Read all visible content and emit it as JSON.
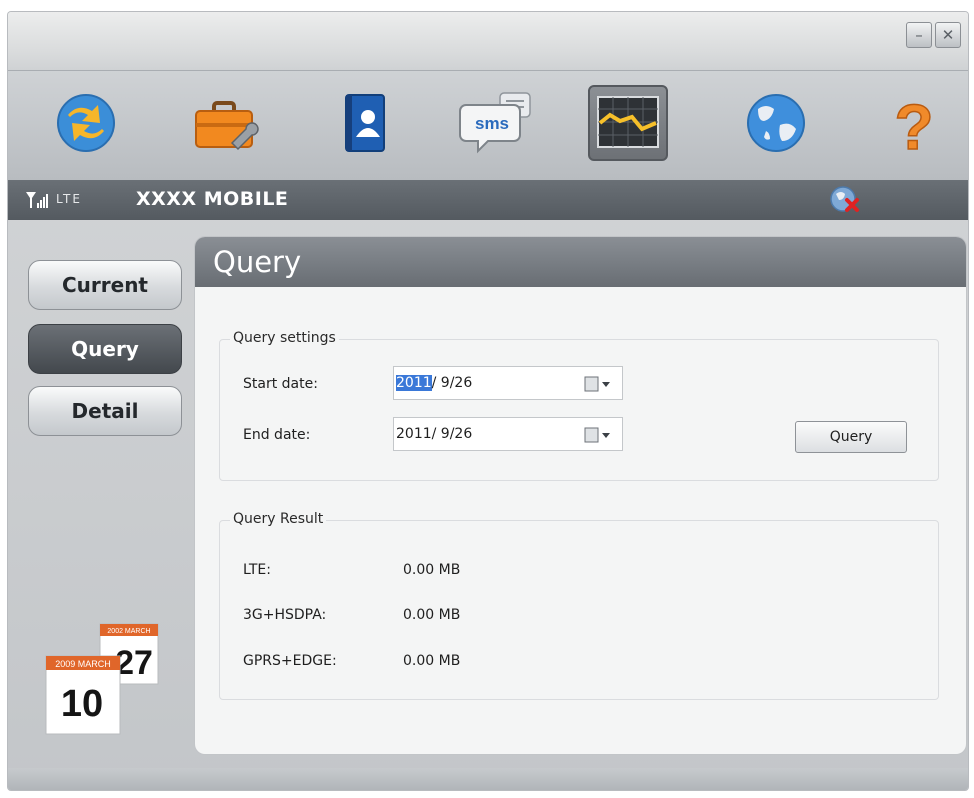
{
  "window": {
    "minimize_label": "–",
    "close_label": "✕"
  },
  "toolbar": {
    "items": [
      {
        "name": "connect",
        "icon": "globe-refresh-icon"
      },
      {
        "name": "settings",
        "icon": "toolbox-icon"
      },
      {
        "name": "contacts",
        "icon": "contact-book-icon"
      },
      {
        "name": "sms",
        "icon": "sms-bubble-icon",
        "label": "sms"
      },
      {
        "name": "statistics",
        "icon": "chart-icon",
        "active": true
      },
      {
        "name": "internet",
        "icon": "globe-icon"
      },
      {
        "name": "help",
        "icon": "question-icon",
        "label": "?"
      }
    ]
  },
  "status": {
    "network_type": "LTE",
    "carrier": "XXXX MOBILE"
  },
  "nav": {
    "current": "Current",
    "query": "Query",
    "detail": "Detail",
    "active": "Query"
  },
  "calendar_art": {
    "back_month": "2002 MARCH",
    "back_day": "27",
    "front_month": "2009 MARCH",
    "front_day": "10"
  },
  "panel": {
    "title": "Query"
  },
  "query_settings": {
    "title": "Query settings",
    "start_label": "Start date:",
    "start_year": "2011",
    "start_rest": "/  9/26",
    "end_label": "End date:",
    "end_value": "2011/  9/26",
    "button_label": "Query"
  },
  "query_result": {
    "title": "Query Result",
    "rows": [
      {
        "label": "LTE:",
        "value": "0.00 MB"
      },
      {
        "label": "3G+HSDPA:",
        "value": "0.00 MB"
      },
      {
        "label": "GPRS+EDGE:",
        "value": "0.00 MB"
      }
    ]
  },
  "colors": {
    "accent_blue": "#3a78d8",
    "header_gray": "#686d73",
    "calendar_orange": "#e0662a"
  }
}
